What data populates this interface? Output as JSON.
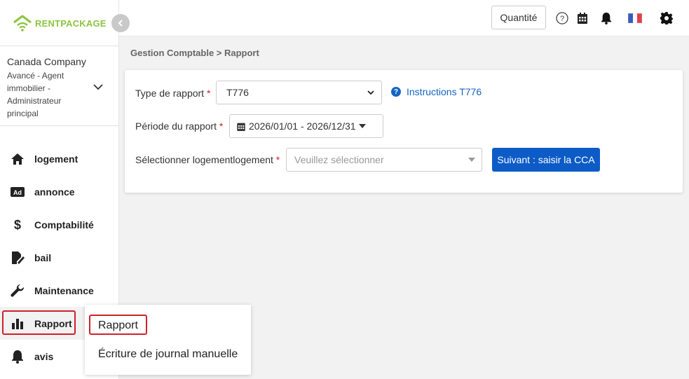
{
  "brand": {
    "logo_part1": "RENT",
    "logo_part2": "PACKAGE",
    "color": "#8cc63f"
  },
  "company": {
    "name": "Canada Company",
    "role": "Avancé - Agent immobilier - Administrateur principal"
  },
  "sidebar": {
    "items": [
      {
        "label": "logement",
        "icon": "home-icon"
      },
      {
        "label": "annonce",
        "icon": "ad-icon"
      },
      {
        "label": "Comptabilité",
        "icon": "dollar-icon"
      },
      {
        "label": "bail",
        "icon": "signature-icon"
      },
      {
        "label": "Maintenance",
        "icon": "wrench-icon"
      },
      {
        "label": "Rapport",
        "icon": "bar-chart-icon",
        "active": true
      },
      {
        "label": "avis",
        "icon": "bell-icon"
      }
    ]
  },
  "topbar": {
    "quantity_label": "Quantité",
    "icons": [
      "help-icon",
      "calendar-icon",
      "bell-icon",
      "flag-fr-icon",
      "gear-icon"
    ]
  },
  "breadcrumb": "Gestion Comptable > Rapport",
  "form": {
    "report_type_label": "Type de rapport",
    "report_type_value": "T776",
    "instructions_link": "Instructions T776",
    "period_label": "Période du rapport",
    "period_value": "2026/01/01 - 2026/12/31",
    "property_label": "Sélectionner logementlogement",
    "property_placeholder": "Veuillez sélectionner",
    "next_button": "Suivant : saisir la CCA",
    "required_mark": "*"
  },
  "submenu": {
    "items": [
      "Rapport",
      "Écriture de journal manuelle"
    ]
  },
  "colors": {
    "accent": "#0d5bc6",
    "highlight": "#d0202b",
    "link": "#1565c0"
  }
}
